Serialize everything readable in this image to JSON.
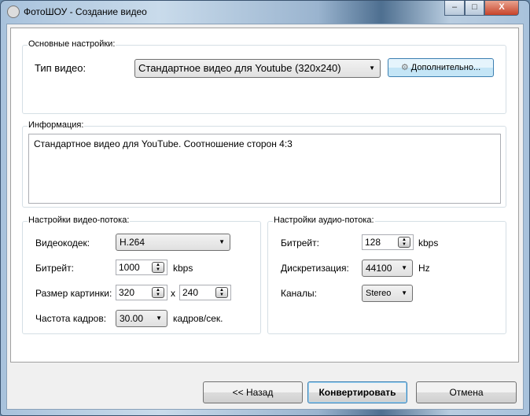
{
  "window": {
    "title": "ФотоШОУ - Создание видео",
    "minimize": "‒",
    "maximize": "□",
    "close": "X"
  },
  "basic": {
    "group_label": "Основные настройки:",
    "type_label": "Тип видео:",
    "type_value": "Стандартное видео для Youtube (320x240)",
    "advanced_button": "Дополнительно..."
  },
  "info": {
    "group_label": "Информация:",
    "text": "Стандартное видео для YouTube. Соотношение сторон 4:3"
  },
  "video": {
    "group_label": "Настройки видео-потока:",
    "codec_label": "Видеокодек:",
    "codec_value": "H.264",
    "bitrate_label": "Битрейт:",
    "bitrate_value": "1000",
    "bitrate_unit": "kbps",
    "size_label": "Размер картинки:",
    "width_value": "320",
    "x_sep": "x",
    "height_value": "240",
    "fps_label": "Частота кадров:",
    "fps_value": "30.00",
    "fps_unit": "кадров/сек."
  },
  "audio": {
    "group_label": "Настройки аудио-потока:",
    "bitrate_label": "Битрейт:",
    "bitrate_value": "128",
    "bitrate_unit": "kbps",
    "sampling_label": "Дискретизация:",
    "sampling_value": "44100",
    "sampling_unit": "Hz",
    "channels_label": "Каналы:",
    "channels_value": "Stereo"
  },
  "footer": {
    "back": "<< Назад",
    "convert": "Конвертировать",
    "cancel": "Отмена"
  }
}
